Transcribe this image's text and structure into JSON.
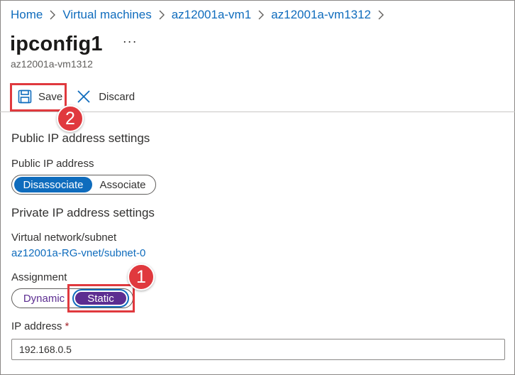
{
  "breadcrumb": {
    "items": [
      "Home",
      "Virtual machines",
      "az12001a-vm1",
      "az12001a-vm1312"
    ]
  },
  "header": {
    "title": "ipconfig1",
    "more_label": "···",
    "subtitle": "az12001a-vm1312"
  },
  "toolbar": {
    "save_label": "Save",
    "discard_label": "Discard",
    "save_icon": "save-icon",
    "discard_icon": "close-icon"
  },
  "public_ip": {
    "section_title": "Public IP address settings",
    "label": "Public IP address",
    "options": [
      "Disassociate",
      "Associate"
    ],
    "selected": "Disassociate"
  },
  "private_ip": {
    "section_title": "Private IP address settings",
    "vnet_label": "Virtual network/subnet",
    "vnet_value": "az12001a-RG-vnet/subnet-0",
    "assignment_label": "Assignment",
    "assignment_options": [
      "Dynamic",
      "Static"
    ],
    "assignment_selected": "Static",
    "ip_label": "IP address",
    "ip_required_mark": "*",
    "ip_value": "192.168.0.5"
  },
  "callouts": {
    "step_1": "1",
    "step_2": "2"
  },
  "colors": {
    "link": "#0f6cbd",
    "toggle_selected_blue": "#0f6cbd",
    "toggle_selected_purple": "#5c2d91",
    "callout_red": "#e0393e",
    "required_red": "#a4262c"
  }
}
